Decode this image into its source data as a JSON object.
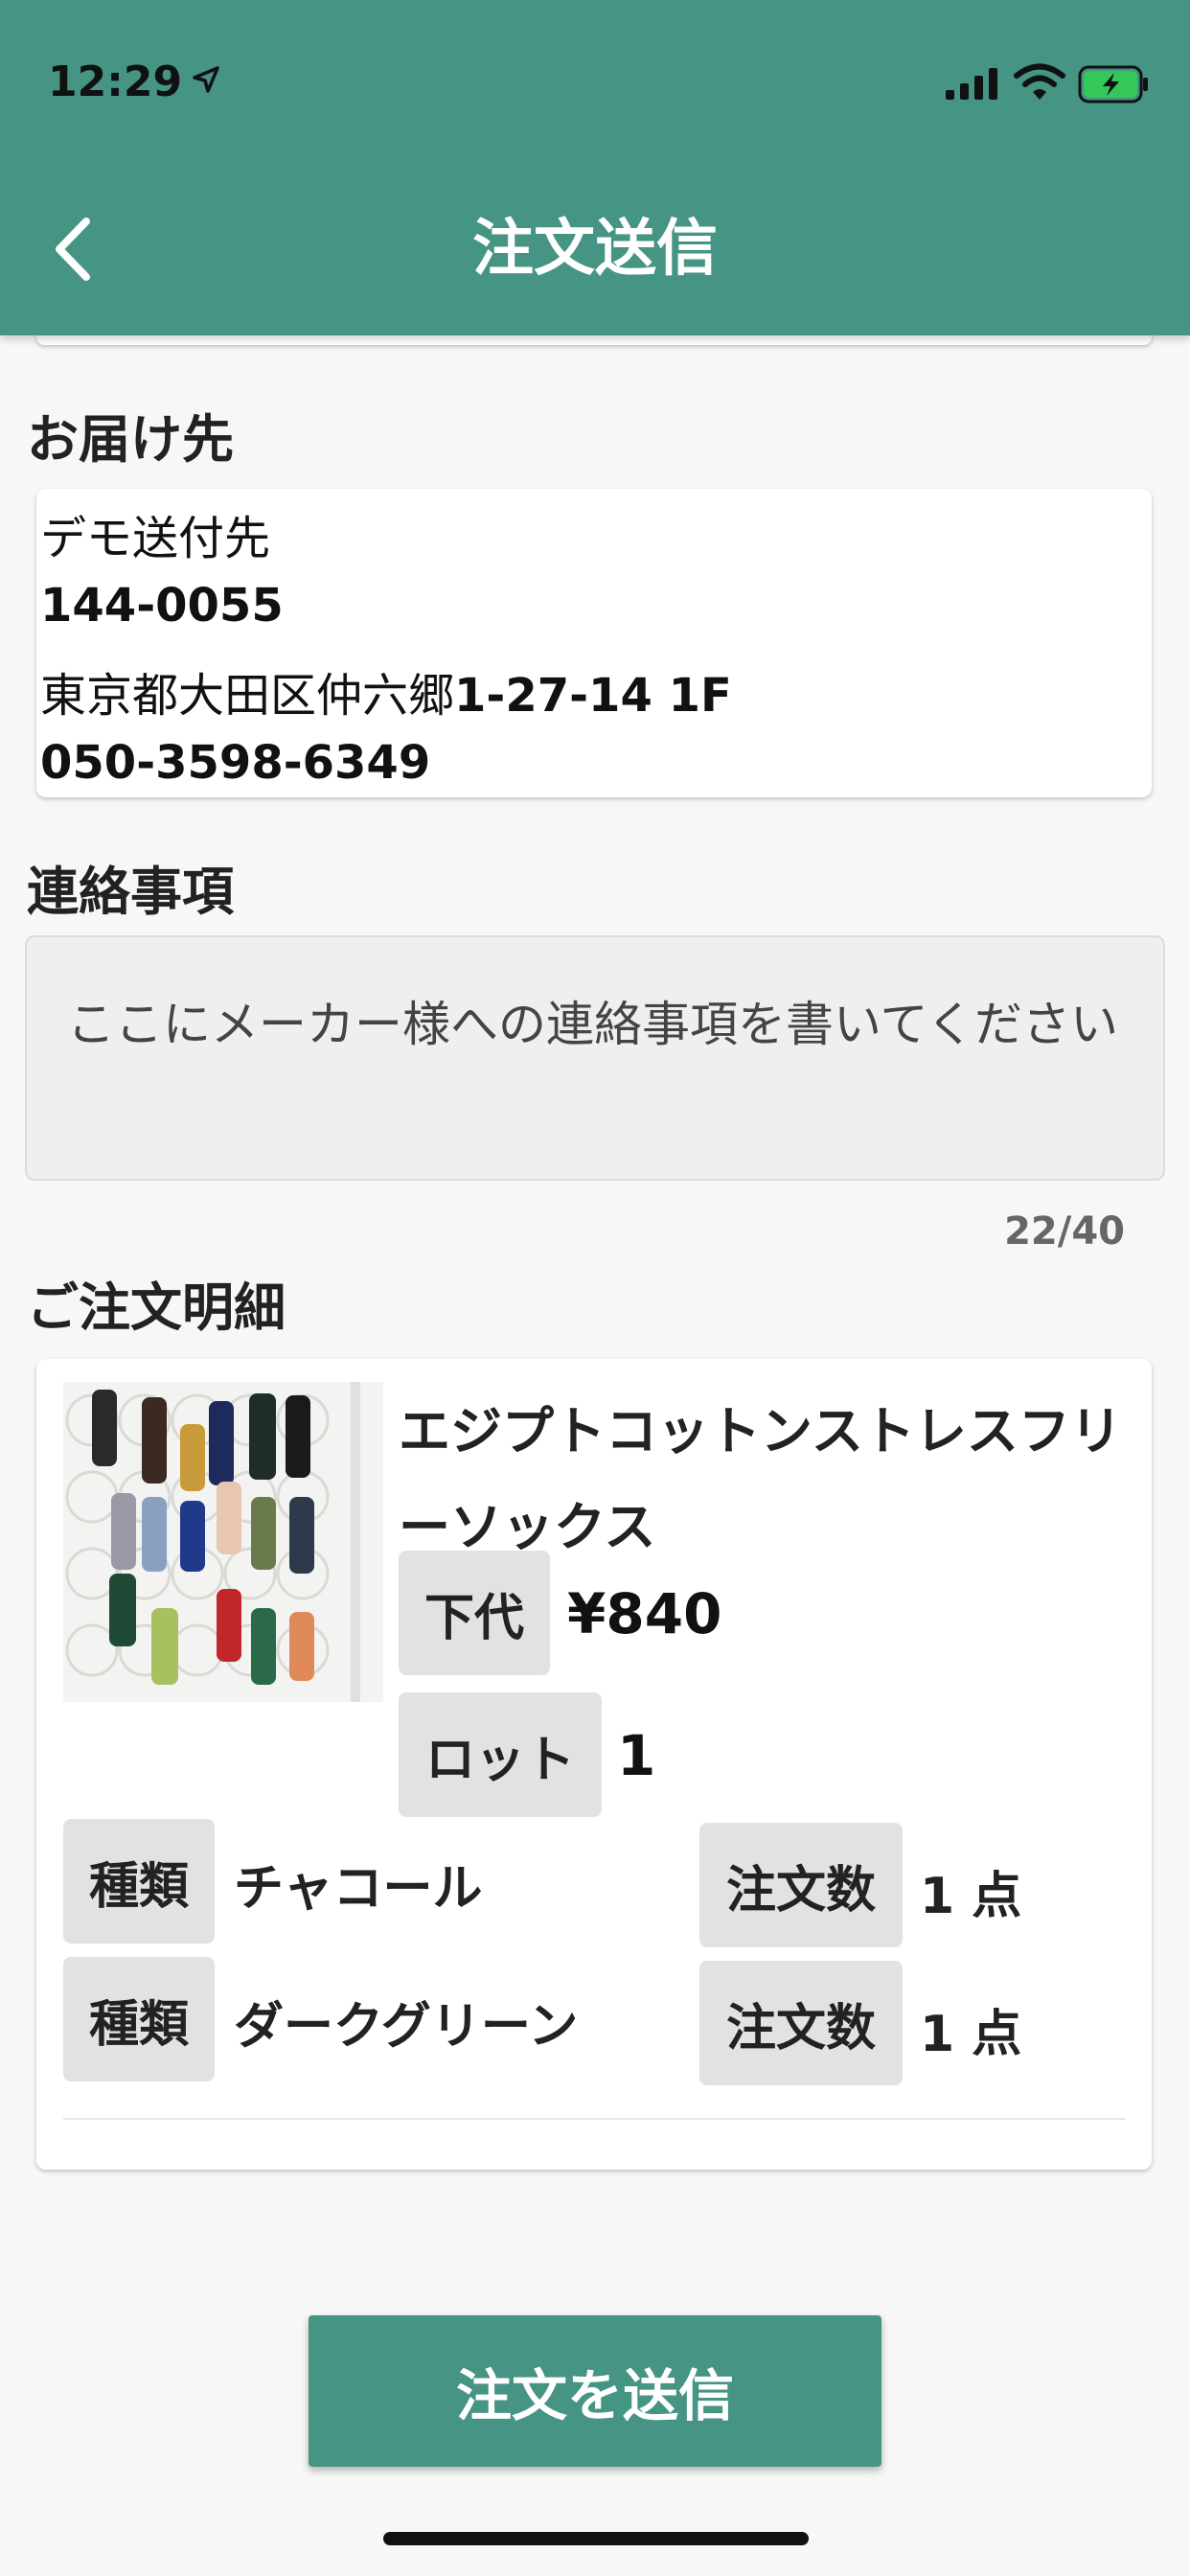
{
  "status_bar": {
    "time": "12:29"
  },
  "header": {
    "title": "注文送信",
    "back_icon": "chevron-left-icon",
    "color": "#459484"
  },
  "delivery": {
    "section_label": "お届け先",
    "name": "デモ送付先",
    "postal_code": "144-0055",
    "address_text": "東京都大田区仲六郷",
    "address_number": "1-27-14 1F",
    "phone": "050-3598-6349"
  },
  "notes": {
    "section_label": "連絡事項",
    "placeholder": "ここにメーカー様への連絡事項を書いてください",
    "char_count": "22/40"
  },
  "order": {
    "section_label": "ご注文明細",
    "product_name": "エジプトコットンストレスフリーソックス",
    "price_label": "下代",
    "price": "¥840",
    "lot_label": "ロット",
    "lot": "1",
    "variants": [
      {
        "type_label": "種類",
        "type": "チャコール",
        "qty_label": "注文数",
        "qty": "1",
        "qty_unit": "点"
      },
      {
        "type_label": "種類",
        "type": "ダークグリーン",
        "qty_label": "注文数",
        "qty": "1",
        "qty_unit": "点"
      }
    ]
  },
  "submit": {
    "label": "注文を送信"
  }
}
